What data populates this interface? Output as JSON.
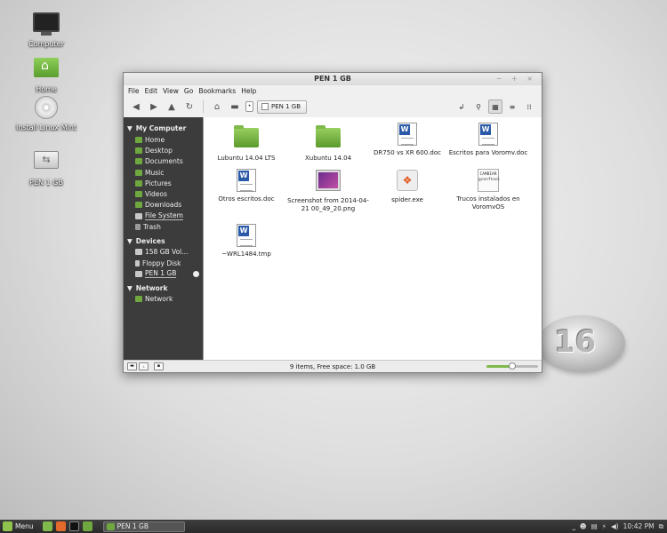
{
  "desktop": {
    "icons": [
      {
        "label": "Computer"
      },
      {
        "label": "Home"
      },
      {
        "label": "Install Linux Mint"
      },
      {
        "label": "PEN 1 GB"
      }
    ],
    "badge_text": "16"
  },
  "window": {
    "title": "PEN 1 GB",
    "controls": "− + ×",
    "menu": [
      "File",
      "Edit",
      "View",
      "Go",
      "Bookmarks",
      "Help"
    ],
    "location_label": "PEN 1 GB",
    "sidebar": {
      "sections": [
        {
          "title": "My Computer",
          "items": [
            "Home",
            "Desktop",
            "Documents",
            "Music",
            "Pictures",
            "Videos",
            "Downloads",
            "File System",
            "Trash"
          ]
        },
        {
          "title": "Devices",
          "items": [
            "158 GB Vol...",
            "Floppy Disk",
            "PEN 1 GB"
          ]
        },
        {
          "title": "Network",
          "items": [
            "Network"
          ]
        }
      ]
    },
    "files": [
      {
        "name": "Lubuntu 14.04 LTS",
        "type": "folder"
      },
      {
        "name": "Xubuntu 14.04",
        "type": "folder"
      },
      {
        "name": "DR750 vs XR 600.doc",
        "type": "doc"
      },
      {
        "name": "Escritos para Voromv.doc",
        "type": "doc"
      },
      {
        "name": "Otros escritos.doc",
        "type": "doc"
      },
      {
        "name": "Screenshot from 2014-04-21 00_49_20.png",
        "type": "png"
      },
      {
        "name": "spider.exe",
        "type": "exe"
      },
      {
        "name": "Trucos instalados en VoromvOS",
        "type": "txt",
        "icon_text": "CAMBIAR gconftool"
      },
      {
        "name": "~WRL1484.tmp",
        "type": "doc"
      }
    ],
    "status": "9 items, Free space: 1.0 GB",
    "zoom_fraction": 0.5
  },
  "panel": {
    "menu_label": "Menu",
    "task_label": "PEN 1 GB",
    "clock": "10:42 PM"
  }
}
